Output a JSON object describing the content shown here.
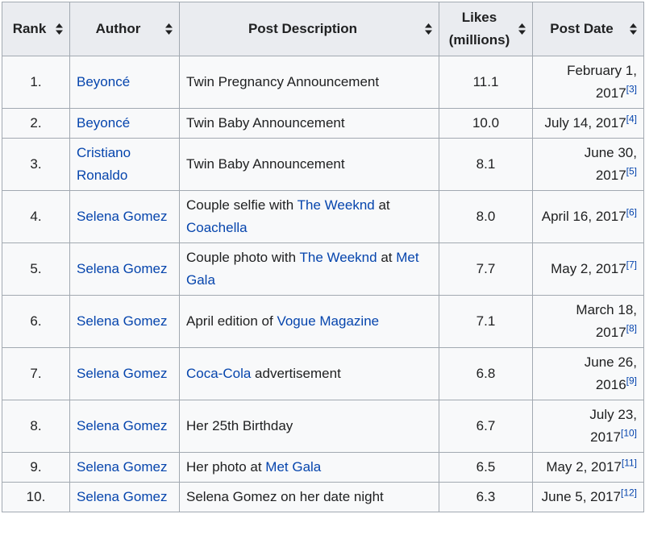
{
  "table": {
    "columns": [
      {
        "label": "Rank"
      },
      {
        "label": "Author"
      },
      {
        "label": "Post Description"
      },
      {
        "label": "Likes (millions)"
      },
      {
        "label": "Post Date"
      }
    ],
    "rows": [
      {
        "rank": "1.",
        "author": "Beyoncé",
        "desc": [
          {
            "text": "Twin Pregnancy Announcement",
            "link": false
          }
        ],
        "likes": "11.1",
        "date": "February 1, 2017",
        "ref": "[3]"
      },
      {
        "rank": "2.",
        "author": "Beyoncé",
        "desc": [
          {
            "text": "Twin Baby Announcement",
            "link": false
          }
        ],
        "likes": "10.0",
        "date": "July 14, 2017",
        "ref": "[4]"
      },
      {
        "rank": "3.",
        "author": "Cristiano Ronaldo",
        "desc": [
          {
            "text": "Twin Baby Announcement",
            "link": false
          }
        ],
        "likes": "8.1",
        "date": "June 30, 2017",
        "ref": "[5]"
      },
      {
        "rank": "4.",
        "author": "Selena Gomez",
        "desc": [
          {
            "text": "Couple selfie with ",
            "link": false
          },
          {
            "text": "The Weeknd",
            "link": true
          },
          {
            "text": " at ",
            "link": false
          },
          {
            "text": "Coachella",
            "link": true
          }
        ],
        "likes": "8.0",
        "date": "April 16, 2017",
        "ref": "[6]"
      },
      {
        "rank": "5.",
        "author": "Selena Gomez",
        "desc": [
          {
            "text": "Couple photo with ",
            "link": false
          },
          {
            "text": "The Weeknd",
            "link": true
          },
          {
            "text": " at ",
            "link": false
          },
          {
            "text": "Met Gala",
            "link": true
          }
        ],
        "likes": "7.7",
        "date": "May 2, 2017",
        "ref": "[7]"
      },
      {
        "rank": "6.",
        "author": "Selena Gomez",
        "desc": [
          {
            "text": "April edition of ",
            "link": false
          },
          {
            "text": "Vogue Magazine",
            "link": true
          }
        ],
        "likes": "7.1",
        "date": "March 18, 2017",
        "ref": "[8]"
      },
      {
        "rank": "7.",
        "author": "Selena Gomez",
        "desc": [
          {
            "text": "Coca-Cola",
            "link": true
          },
          {
            "text": " advertisement",
            "link": false
          }
        ],
        "likes": "6.8",
        "date": "June 26, 2016",
        "ref": "[9]"
      },
      {
        "rank": "8.",
        "author": "Selena Gomez",
        "desc": [
          {
            "text": "Her 25th Birthday",
            "link": false
          }
        ],
        "likes": "6.7",
        "date": "July 23, 2017",
        "ref": "[10]"
      },
      {
        "rank": "9.",
        "author": "Selena Gomez",
        "desc": [
          {
            "text": "Her photo at ",
            "link": false
          },
          {
            "text": "Met Gala",
            "link": true
          }
        ],
        "likes": "6.5",
        "date": "May 2, 2017",
        "ref": "[11]"
      },
      {
        "rank": "10.",
        "author": "Selena Gomez",
        "desc": [
          {
            "text": "Selena Gomez on her date night",
            "link": false
          }
        ],
        "likes": "6.3",
        "date": "June 5, 2017",
        "ref": "[12]"
      }
    ]
  },
  "colors": {
    "link": "#0645ad",
    "header_bg": "#eaecf0",
    "cell_bg": "#f8f9fa",
    "border": "#a2a9b1"
  }
}
